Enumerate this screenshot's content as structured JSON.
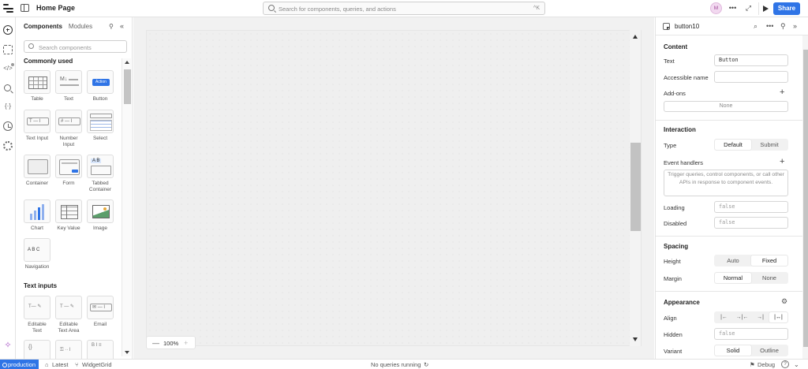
{
  "topbar": {
    "page_title": "Home Page",
    "search_placeholder": "Search for components, queries, and actions",
    "search_shortcut": "^K",
    "avatar_initial": "M",
    "more_label": "•••",
    "expand_label": "⤢",
    "share_label": "Share"
  },
  "rail": {
    "icons": [
      "add-icon",
      "select-region-icon",
      "code-icon",
      "search-icon",
      "state-icon",
      "history-icon",
      "settings-icon",
      "assist-icon"
    ]
  },
  "components": {
    "tabs": [
      "Components",
      "Modules"
    ],
    "search_placeholder": "Search components",
    "sections": {
      "commonly_used": "Commonly used",
      "text_inputs": "Text inputs"
    },
    "common": [
      {
        "label": "Table"
      },
      {
        "label": "Text"
      },
      {
        "label": "Button",
        "art": "Action"
      },
      {
        "label": "Text Input"
      },
      {
        "label": "Number Input"
      },
      {
        "label": "Select"
      },
      {
        "label": "Container"
      },
      {
        "label": "Form"
      },
      {
        "label": "Tabbed Container",
        "art": "A  B"
      },
      {
        "label": "Chart"
      },
      {
        "label": "Key Value"
      },
      {
        "label": "Image"
      },
      {
        "label": "Navigation",
        "art": "A  B  C"
      }
    ],
    "text_inputs": [
      {
        "label": "Editable Text"
      },
      {
        "label": "Editable Text Area"
      },
      {
        "label": "Email"
      }
    ]
  },
  "canvas": {
    "zoom_minus": "—",
    "zoom": "100%",
    "zoom_plus": "+"
  },
  "inspector": {
    "component_name": "button10",
    "content": {
      "title": "Content",
      "text_label": "Text",
      "text_value": "Button",
      "accessible_label": "Accessible name",
      "accessible_value": "",
      "addons_label": "Add-ons",
      "addons_value": "None"
    },
    "interaction": {
      "title": "Interaction",
      "type_label": "Type",
      "type_options": [
        "Default",
        "Submit"
      ],
      "type_selected": "Default",
      "event_label": "Event handlers",
      "event_hint": "Trigger queries, control components, or call other APIs in response to component events.",
      "loading_label": "Loading",
      "loading_placeholder": "false",
      "disabled_label": "Disabled",
      "disabled_placeholder": "false"
    },
    "spacing": {
      "title": "Spacing",
      "height_label": "Height",
      "height_options": [
        "Auto",
        "Fixed"
      ],
      "height_selected": "Fixed",
      "margin_label": "Margin",
      "margin_options": [
        "Normal",
        "None"
      ],
      "margin_selected": "Normal"
    },
    "appearance": {
      "title": "Appearance",
      "align_label": "Align",
      "align_options": [
        "|←",
        "→|←",
        "→|",
        "|↔|"
      ],
      "align_selected": 3,
      "hidden_label": "Hidden",
      "hidden_placeholder": "false",
      "variant_label": "Variant",
      "variant_options": [
        "Solid",
        "Outline"
      ],
      "variant_selected": "Solid"
    }
  },
  "status": {
    "env": "production",
    "latest": "Latest",
    "branch": "WidgetGrid",
    "queries": "No queries running",
    "debug": "Debug",
    "help": "?"
  },
  "colors": {
    "accent": "#2f74e6",
    "assist": "#a957c7"
  }
}
